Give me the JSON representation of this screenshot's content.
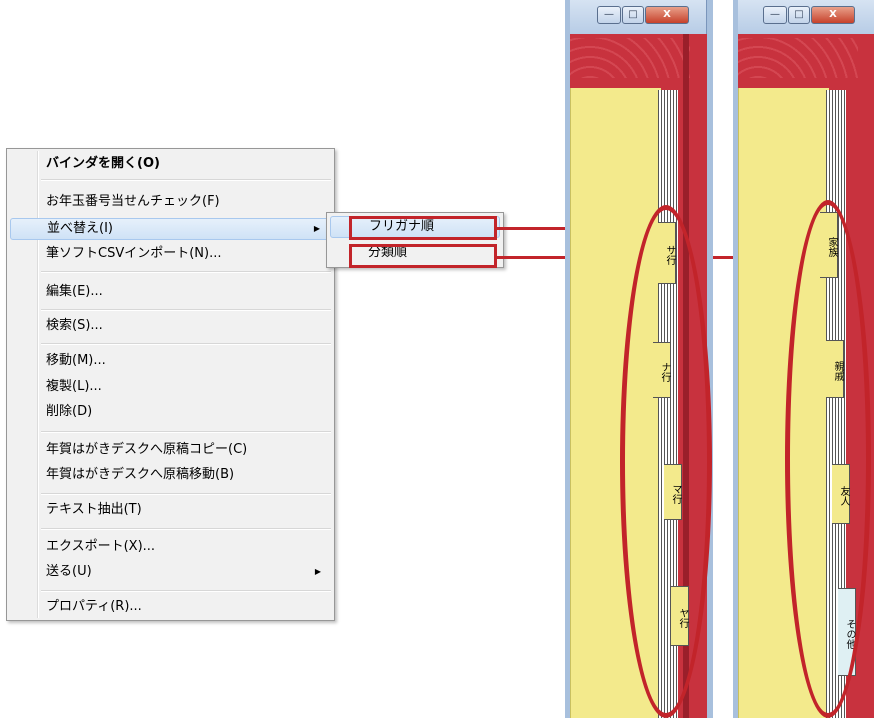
{
  "menu": {
    "items": [
      {
        "label": "バインダを開く(O)"
      },
      {
        "label": "お年玉番号当せんチェック(F)"
      },
      {
        "label": "並べ替え(I)"
      },
      {
        "label": "筆ソフトCSVインポート(N)..."
      },
      {
        "label": "編集(E)..."
      },
      {
        "label": "検索(S)..."
      },
      {
        "label": "移動(M)..."
      },
      {
        "label": "複製(L)..."
      },
      {
        "label": "削除(D)"
      },
      {
        "label": "年賀はがきデスクへ原稿コピー(C)"
      },
      {
        "label": "年賀はがきデスクへ原稿移動(B)"
      },
      {
        "label": "テキスト抽出(T)"
      },
      {
        "label": "エクスポート(X)..."
      },
      {
        "label": "送る(U)"
      },
      {
        "label": "プロパティ(R)..."
      }
    ],
    "submenu_arrow": "▶"
  },
  "submenu": {
    "items": [
      {
        "label": "フリガナ順"
      },
      {
        "label": "分類順"
      }
    ]
  },
  "binder_left": {
    "tabs": [
      "サ行",
      "ナ行",
      "マ行",
      "ヤ行"
    ]
  },
  "binder_right": {
    "tabs": [
      "家族",
      "親戚",
      "友人",
      "その他"
    ]
  },
  "window_buttons": {
    "minimize": "—",
    "maximize": "□",
    "close": "X"
  },
  "colors": {
    "highlight_red": "#c2242a",
    "binder_cover": "#c8323e",
    "page_yellow": "#f3ea8c",
    "menu_bg": "#f1f1f1",
    "selection_blue": "#cfe2f6"
  }
}
